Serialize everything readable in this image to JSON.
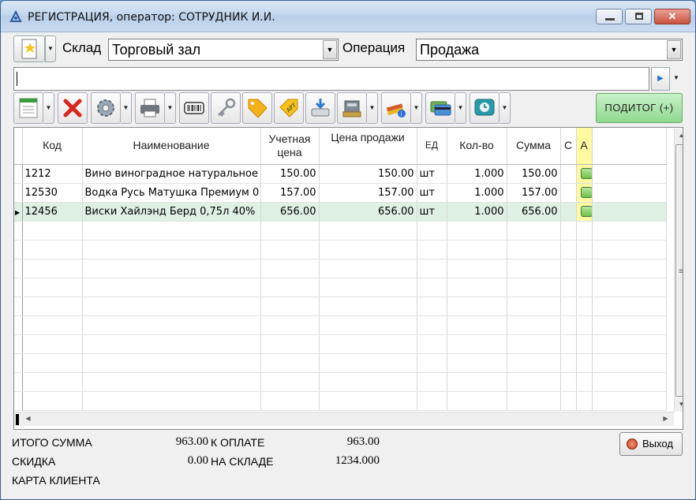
{
  "window": {
    "title": "РЕГИСТРАЦИЯ, оператор: СОТРУДНИК И.И.",
    "minimize_glyph": "▁",
    "close_glyph": "✕"
  },
  "header": {
    "warehouse_label": "Склад",
    "warehouse_value": "Торговый зал",
    "operation_label": "Операция",
    "operation_value": "Продажа"
  },
  "command_line": {
    "value": ""
  },
  "toolbar": {
    "buttons": [
      "new-document",
      "delete",
      "settings",
      "print",
      "barcode",
      "key",
      "price-tag",
      "article",
      "scanner",
      "cash-register",
      "books-info",
      "card-payment",
      "timer"
    ],
    "subtotal_label": "ПОДИТОГ (+)"
  },
  "table": {
    "columns": [
      "Код",
      "Наименование",
      "Учетная\nцена",
      "Цена продажи",
      "ЕД",
      "Кол-во",
      "Сумма",
      "С",
      "А"
    ],
    "rows": [
      {
        "code": "1212",
        "name": "Вино виноградное натуральное",
        "cost": "150.00",
        "price": "150.00",
        "unit": "шт",
        "qty": "1.000",
        "sum": "150.00",
        "a": true
      },
      {
        "code": "12530",
        "name": "Водка Русь Матушка Премиум 0",
        "cost": "157.00",
        "price": "157.00",
        "unit": "шт",
        "qty": "1.000",
        "sum": "157.00",
        "a": true
      },
      {
        "code": "12456",
        "name": "Виски Хайлэнд Берд 0,75л 40%",
        "cost": "656.00",
        "price": "656.00",
        "unit": "шт",
        "qty": "1.000",
        "sum": "656.00",
        "a": true,
        "selected": true
      }
    ]
  },
  "summary": {
    "total_label": "ИТОГО СУММА",
    "total_value": "963.00",
    "to_pay_label": "К ОПЛАТЕ",
    "to_pay_value": "963.00",
    "discount_label": "СКИДКА",
    "discount_value": "0.00",
    "stock_label": "НА СКЛАДЕ",
    "stock_value": "1234.000",
    "client_card_label": "КАРТА КЛИЕНТА"
  },
  "exit_button": {
    "label": "Выход"
  },
  "colors": {
    "selected_row": "#dff0e4",
    "a_column_highlight": "#fff9a0",
    "subtotal_button": "#a7e3a7"
  }
}
